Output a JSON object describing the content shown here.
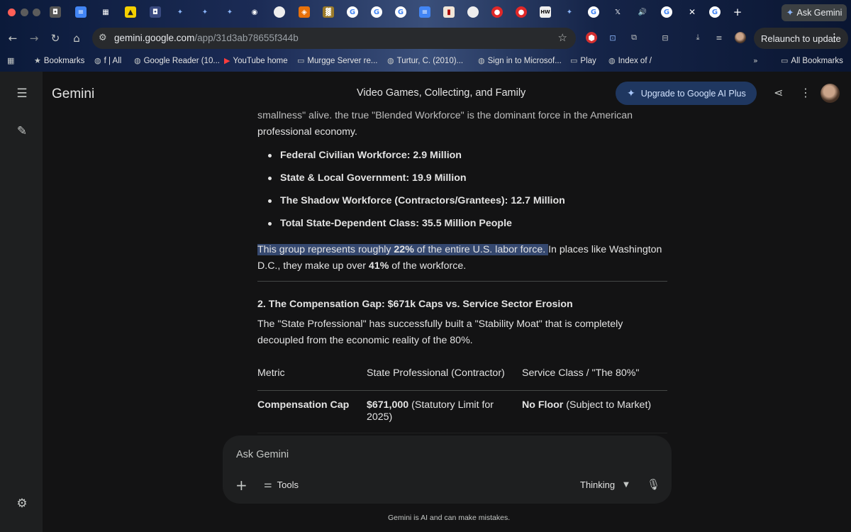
{
  "browser": {
    "ask_gemini_label": "Ask Gemini",
    "url_host": "gemini.google.com",
    "url_path": "/app/31d3ab78655f344b",
    "relaunch_label": "Relaunch to update",
    "bookmarks": [
      {
        "label": "Bookmarks",
        "icon": "star-icon"
      },
      {
        "label": "f | All",
        "icon": "globe-icon"
      },
      {
        "label": "Google Reader (10...",
        "icon": "globe-icon"
      },
      {
        "label": "YouTube home",
        "icon": "youtube-icon"
      },
      {
        "label": "Murgge Server re...",
        "icon": "folder-icon"
      },
      {
        "label": "Turtur, C. (2010)...",
        "icon": "globe-icon"
      },
      {
        "label": "Sign in to Microsof...",
        "icon": "globe-icon"
      },
      {
        "label": "Play",
        "icon": "folder-icon"
      },
      {
        "label": "Index of /",
        "icon": "globe-icon"
      }
    ],
    "all_bookmarks_label": "All Bookmarks"
  },
  "app": {
    "name": "Gemini",
    "conversation_title": "Video Games, Collecting, and Family",
    "upgrade_label": "Upgrade to Google AI Plus"
  },
  "response": {
    "clipped_line": "smallness\" alive, the true \"Blended Workforce\" is the dominant force in the American",
    "intro_line2": "professional economy.",
    "bullets": [
      "Federal Civilian Workforce: 2.9 Million",
      "State & Local Government: 19.9 Million",
      "The Shadow Workforce (Contractors/Grantees): 12.7 Million",
      "Total State-Dependent Class: 35.5 Million People"
    ],
    "para2": {
      "hl_a": "This group represents roughly ",
      "hl_bold": "22%",
      "hl_b": " of the entire U.S. labor force. ",
      "rest_a": "In places like Washington D.C., they make up over ",
      "rest_bold": "41%",
      "rest_b": " of the workforce."
    },
    "section_heading": "2. The Compensation Gap: $671k Caps vs. Service Sector Erosion",
    "section_para": "The \"State Professional\" has successfully built a \"Stability Moat\" that is completely decoupled from the economic reality of the 80%.",
    "table": {
      "headers": [
        "Metric",
        "State Professional (Contractor)",
        "Service Class / \"The 80%\""
      ],
      "rows": [
        {
          "metric": "Compensation Cap",
          "col2_bold": "$671,000",
          "col2_rest": " (Statutory Limit for 2025)",
          "col3_bold": "No Floor",
          "col3_rest": " (Subject to Market)"
        }
      ]
    }
  },
  "input": {
    "placeholder": "Ask Gemini",
    "tools_label": "Tools",
    "model_label": "Thinking"
  },
  "disclaimer": "Gemini is AI and can make mistakes.",
  "colors": {
    "background": "#131314",
    "sidebar": "#1e1f20",
    "highlight": "#35486f",
    "upgrade_button": "#1f3760"
  }
}
